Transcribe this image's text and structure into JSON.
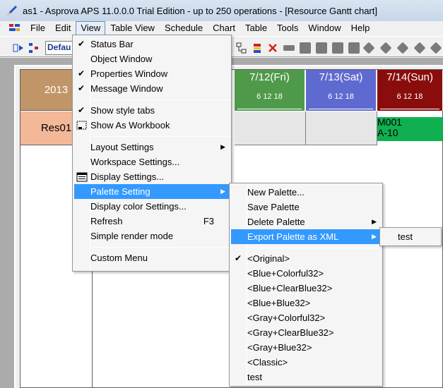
{
  "window": {
    "title": "as1 - Asprova APS 11.0.0.0 Trial Edition  - up to 250 operations - [Resource Gantt chart]"
  },
  "menubar": {
    "items": [
      "File",
      "Edit",
      "View",
      "Table View",
      "Schedule",
      "Chart",
      "Table",
      "Tools",
      "Window",
      "Help"
    ],
    "open_index": 2
  },
  "toolbar": {
    "combo_value": "Defau"
  },
  "gantt": {
    "year": "2013",
    "resource": "Res01",
    "days": [
      {
        "label": "7/12(Fri)",
        "ticks": "6  12  18",
        "color": "#4f9a4a"
      },
      {
        "label": "7/13(Sat)",
        "ticks": "6  12  18",
        "color": "#5f6ad0"
      },
      {
        "label": "7/14(Sun)",
        "ticks": "6  12  18",
        "color": "#8a0d0d"
      }
    ],
    "operation": {
      "line1": "M001",
      "line2": "A-10",
      "color": "#10b050"
    }
  },
  "view_menu": {
    "items": [
      {
        "label": "Status Bar",
        "checked": true
      },
      {
        "label": "Object Window",
        "checked": false
      },
      {
        "label": "Properties Window",
        "checked": true
      },
      {
        "label": "Message Window",
        "checked": true
      },
      {
        "label": "Show style tabs",
        "checked": true
      },
      {
        "label": "Show As Workbook",
        "checked": false
      },
      {
        "label": "Layout Settings",
        "submenu": true
      },
      {
        "label": "Workspace Settings..."
      },
      {
        "label": "Display Settings..."
      },
      {
        "label": "Palette Setting",
        "submenu": true,
        "highlighted": true
      },
      {
        "label": "Display color Settings..."
      },
      {
        "label": "Refresh",
        "shortcut": "F3"
      },
      {
        "label": "Simple render mode"
      },
      {
        "label": "Custom Menu"
      }
    ]
  },
  "palette_menu": {
    "items": [
      {
        "label": "New Palette..."
      },
      {
        "label": "Save Palette"
      },
      {
        "label": "Delete Palette",
        "submenu": true
      },
      {
        "label": "Export Palette as XML",
        "submenu": true,
        "highlighted": true
      },
      {
        "label": "<Original>",
        "checked": true
      },
      {
        "label": "<Blue+Colorful32>"
      },
      {
        "label": "<Blue+ClearBlue32>"
      },
      {
        "label": "<Blue+Blue32>"
      },
      {
        "label": "<Gray+Colorful32>"
      },
      {
        "label": "<Gray+ClearBlue32>"
      },
      {
        "label": "<Gray+Blue32>"
      },
      {
        "label": "<Classic>"
      },
      {
        "label": "test"
      }
    ]
  },
  "export_menu": {
    "items": [
      {
        "label": "test"
      }
    ]
  }
}
